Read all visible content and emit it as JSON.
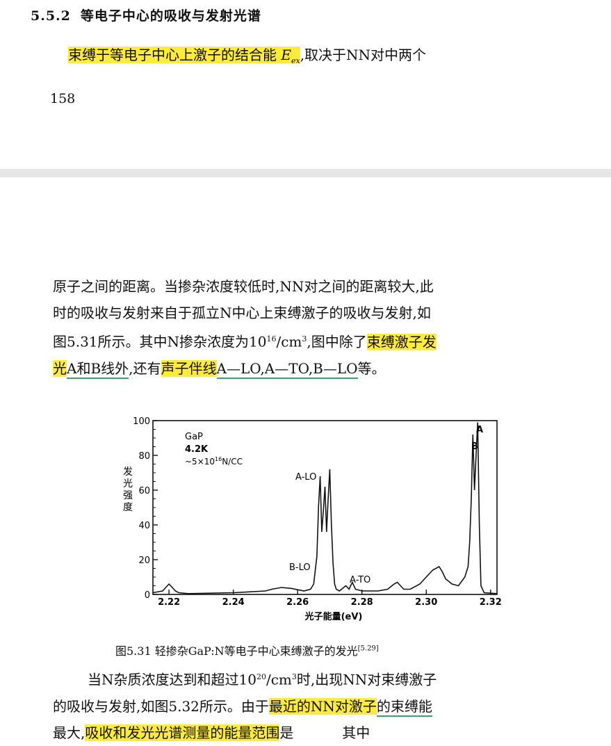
{
  "page1": {
    "section_number": "5.5.2",
    "section_title": "等电子中心的吸收与发射光谱",
    "line_highlight": "束缚于等电子中心上激子的结合能 ",
    "line_highlight_var": "E",
    "line_highlight_sub": "ex",
    "line_rest": ",取决于NN对中两个",
    "page_number": "158"
  },
  "para1": {
    "l1": "原子之间的距离。当掺杂浓度较低时,NN对之间的距离较大,此",
    "l2": "时的吸收与发射来自于孤立N中心上束缚激子的吸收与发射,如",
    "l3_a": "图5.31所示。其中N掺杂浓度为10",
    "l3_sup": "16",
    "l3_b": "/cm",
    "l3_sup2": "3",
    "l3_c": ",图中除了",
    "l3_hl": "束缚激子发",
    "l4_hl": "光",
    "l4_ul1": "A和B线外",
    "l4_mid": ",还有",
    "l4_hl2": "声子伴线",
    "l4_ul2": "A—LO,A—TO,B—LO",
    "l4_end": "等。"
  },
  "figure": {
    "annotation_lines": [
      "GaP",
      "4.2K",
      "~5×10",
      "16",
      "N/CC"
    ],
    "ylabel": "发光强度",
    "xlabel": "光子能量(eV)",
    "peak_labels": [
      "A-LO",
      "B-LO",
      "A-TO",
      "A",
      "B"
    ]
  },
  "caption": {
    "text": "图5.31 轻掺杂GaP:N等电子中心束缚激子的发光",
    "ref": "[5.29]"
  },
  "para2": {
    "l1_a": "当N杂质浓度达到和超过10",
    "l1_sup": "20",
    "l1_b": "/cm",
    "l1_sup2": "3",
    "l1_c": "时,出现NN对束缚激子",
    "l2_a": "的吸收与发射,如图5.32所示。由于",
    "l2_hl": "最近的NN对激子",
    "l2_ul": "的束缚能",
    "l3_a": "最大,",
    "l3_hl": "吸收和发光光谱测量的能量范围",
    "l3_b": "是",
    "l3_c": "其中"
  },
  "chart_data": {
    "type": "line",
    "title": "",
    "xlabel": "光子能量(eV)",
    "ylabel": "发光强度",
    "xlim": [
      2.215,
      2.322
    ],
    "ylim": [
      0,
      100
    ],
    "xticks": [
      2.22,
      2.24,
      2.26,
      2.28,
      2.3,
      2.32
    ],
    "yticks": [
      0,
      20,
      40,
      60,
      80,
      100
    ],
    "series": [
      {
        "x": [
          2.215,
          2.218,
          2.219,
          2.22,
          2.221,
          2.222,
          2.223,
          2.226,
          2.24,
          2.245,
          2.25,
          2.252,
          2.255,
          2.258,
          2.262,
          2.264,
          2.265,
          2.266,
          2.2665,
          2.267,
          2.2675,
          2.268,
          2.2685,
          2.269,
          2.2695,
          2.27,
          2.2705,
          2.271,
          2.2715,
          2.272,
          2.273,
          2.275,
          2.276,
          2.277,
          2.278,
          2.28,
          2.285,
          2.288,
          2.29,
          2.291,
          2.292,
          2.293,
          2.295,
          2.298,
          2.3,
          2.302,
          2.304,
          2.305,
          2.306,
          2.308,
          2.31,
          2.312,
          2.313,
          2.3135,
          2.314,
          2.3145,
          2.315,
          2.3155,
          2.316,
          2.3165,
          2.317,
          2.318,
          2.322
        ],
        "y": [
          1,
          2,
          4,
          6,
          4,
          2,
          1,
          0.5,
          1,
          1.5,
          2,
          3,
          4,
          3.5,
          2,
          3,
          6,
          22,
          50,
          68,
          36,
          48,
          62,
          36,
          55,
          72,
          40,
          18,
          6,
          3,
          2,
          5,
          3,
          7,
          3,
          2,
          2,
          3,
          6,
          7,
          5,
          3,
          3,
          6,
          10,
          14,
          16,
          13,
          9,
          6,
          5,
          10,
          16,
          30,
          55,
          92,
          60,
          80,
          99,
          40,
          5,
          1,
          0.5
        ]
      }
    ]
  }
}
